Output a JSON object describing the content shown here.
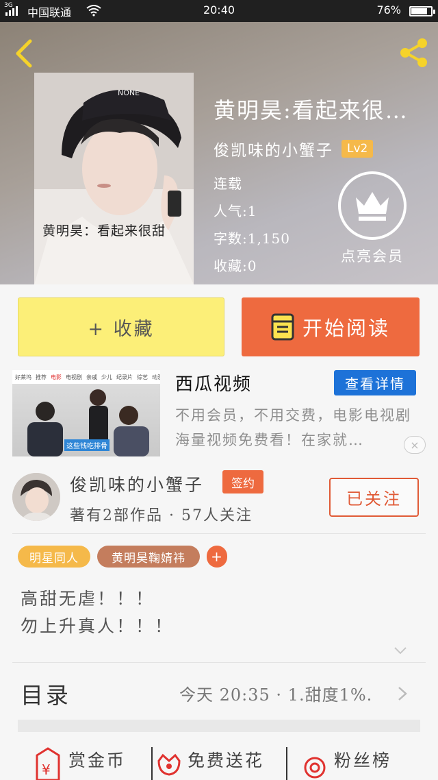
{
  "status_bar": {
    "network": "3G",
    "carrier": "中国联通",
    "time": "20:40",
    "battery": "76%"
  },
  "book": {
    "title": "黄明昊:看起来很…",
    "author": "俊凯味的小蟹子",
    "author_level": "Lv2",
    "status": "连载",
    "popularity": "人气:1",
    "word_count": "字数:1,150",
    "favorites": "收藏:0",
    "cover_caption": "黄明昊：看起来很甜",
    "vip_label": "点亮会员"
  },
  "actions": {
    "collect_label": "+ 收藏",
    "read_label": "开始阅读"
  },
  "ad": {
    "nav_items": [
      "好莱坞",
      "推荐",
      "电影",
      "电视剧",
      "亲戚",
      "少儿",
      "纪录片",
      "综艺",
      "动漫"
    ],
    "nav_highlight": "电影",
    "subtitle": "这些钱吃排骨",
    "title": "西瓜视频",
    "button": "查看详情",
    "description": "不用会员，不用交费，电影电视剧海量视频免费看！在家就…",
    "close": "×"
  },
  "author_card": {
    "name": "俊凯味的小蟹子",
    "badge": "签约",
    "stats": "著有2部作品 · 57人关注",
    "follow_label": "已关注"
  },
  "tags": [
    "明星同人",
    "黄明昊鞠婧祎",
    "+"
  ],
  "intro": [
    "高甜无虐！！！",
    "勿上升真人！！！"
  ],
  "catalog": {
    "title": "目录",
    "latest": "今天 20:35 · 1.甜度1%."
  },
  "bottom_bar": [
    {
      "label": "赏金币",
      "icon": "red-envelope-icon"
    },
    {
      "label": "免费送花",
      "icon": "flower-icon"
    },
    {
      "label": "粉丝榜",
      "icon": "medal-icon"
    }
  ],
  "colors": {
    "accent": "#ee6a3f",
    "collect_bg": "#fcef78",
    "level_badge": "#f5b94a",
    "ad_button": "#1d72d8",
    "tag_brown": "#c47d5d"
  }
}
